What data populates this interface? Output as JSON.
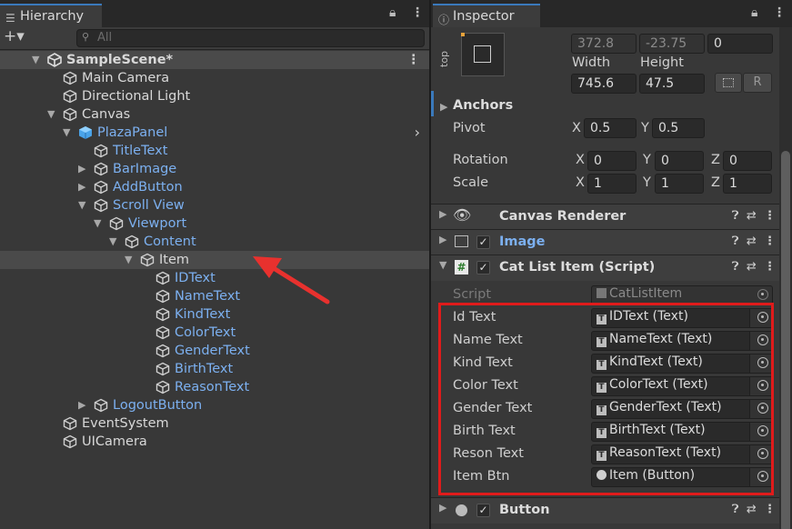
{
  "hierarchy": {
    "tab_title": "Hierarchy",
    "search_placeholder": "All",
    "add_symbol": "+▾",
    "rows": [
      {
        "label": "SampleScene*",
        "depth": 0,
        "arrow": "down",
        "icon": "unity-scene-icon",
        "color": "white",
        "type": "scene"
      },
      {
        "label": "Main Camera",
        "depth": 1,
        "arrow": "",
        "icon": "gameobject-cube-icon",
        "color": "white"
      },
      {
        "label": "Directional Light",
        "depth": 1,
        "arrow": "",
        "icon": "gameobject-cube-icon",
        "color": "white"
      },
      {
        "label": "Canvas",
        "depth": 1,
        "arrow": "down",
        "icon": "gameobject-cube-icon",
        "color": "white"
      },
      {
        "label": "PlazaPanel",
        "depth": 2,
        "arrow": "down",
        "icon": "prefab-cube-icon",
        "color": "blue",
        "chevron": true
      },
      {
        "label": "TitleText",
        "depth": 3,
        "arrow": "",
        "icon": "gameobject-cube-icon",
        "color": "blue"
      },
      {
        "label": "BarImage",
        "depth": 3,
        "arrow": "right",
        "icon": "gameobject-cube-icon",
        "color": "blue"
      },
      {
        "label": "AddButton",
        "depth": 3,
        "arrow": "right",
        "icon": "gameobject-cube-icon",
        "color": "blue"
      },
      {
        "label": "Scroll View",
        "depth": 3,
        "arrow": "down",
        "icon": "gameobject-cube-icon",
        "color": "blue"
      },
      {
        "label": "Viewport",
        "depth": 4,
        "arrow": "down",
        "icon": "gameobject-cube-icon",
        "color": "blue"
      },
      {
        "label": "Content",
        "depth": 5,
        "arrow": "down",
        "icon": "gameobject-cube-icon",
        "color": "blue"
      },
      {
        "label": "Item",
        "depth": 6,
        "arrow": "down",
        "icon": "gameobject-cube-icon",
        "color": "white",
        "selected": true
      },
      {
        "label": "IDText",
        "depth": 7,
        "arrow": "",
        "icon": "gameobject-cube-icon",
        "color": "blue"
      },
      {
        "label": "NameText",
        "depth": 7,
        "arrow": "",
        "icon": "gameobject-cube-icon",
        "color": "blue"
      },
      {
        "label": "KindText",
        "depth": 7,
        "arrow": "",
        "icon": "gameobject-cube-icon",
        "color": "blue"
      },
      {
        "label": "ColorText",
        "depth": 7,
        "arrow": "",
        "icon": "gameobject-cube-icon",
        "color": "blue"
      },
      {
        "label": "GenderText",
        "depth": 7,
        "arrow": "",
        "icon": "gameobject-cube-icon",
        "color": "blue"
      },
      {
        "label": "BirthText",
        "depth": 7,
        "arrow": "",
        "icon": "gameobject-cube-icon",
        "color": "blue"
      },
      {
        "label": "ReasonText",
        "depth": 7,
        "arrow": "",
        "icon": "gameobject-cube-icon",
        "color": "blue"
      },
      {
        "label": "LogoutButton",
        "depth": 3,
        "arrow": "right",
        "icon": "gameobject-cube-icon",
        "color": "blue"
      },
      {
        "label": "EventSystem",
        "depth": 1,
        "arrow": "",
        "icon": "gameobject-cube-icon",
        "color": "white"
      },
      {
        "label": "UICamera",
        "depth": 1,
        "arrow": "",
        "icon": "gameobject-cube-icon",
        "color": "white"
      }
    ]
  },
  "inspector": {
    "tab_title": "Inspector",
    "rect": {
      "anchor_preset_label": "top",
      "pos_x": "372.8",
      "pos_y": "-23.75",
      "pos_z": "0",
      "width_label": "Width",
      "height_label": "Height",
      "width": "745.6",
      "height": "47.5",
      "raw_button": "R"
    },
    "anchors_label": "Anchors",
    "pivot": {
      "label": "Pivot",
      "x_label": "X",
      "y_label": "Y",
      "x": "0.5",
      "y": "0.5"
    },
    "rotation": {
      "label": "Rotation",
      "x_label": "X",
      "y_label": "Y",
      "z_label": "Z",
      "x": "0",
      "y": "0",
      "z": "0"
    },
    "scale": {
      "label": "Scale",
      "x_label": "X",
      "y_label": "Y",
      "z_label": "Z",
      "x": "1",
      "y": "1",
      "z": "1"
    },
    "components": {
      "canvas_renderer": "Canvas Renderer",
      "image": "Image",
      "cat_list_item": "Cat List Item (Script)",
      "button": "Button"
    },
    "script_field": {
      "label": "Script",
      "value": "CatListItem"
    },
    "fields": [
      {
        "label": "Id Text",
        "value": "IDText (Text)",
        "icon": "T"
      },
      {
        "label": "Name Text",
        "value": "NameText (Text)",
        "icon": "T"
      },
      {
        "label": "Kind Text",
        "value": "KindText (Text)",
        "icon": "T"
      },
      {
        "label": "Color Text",
        "value": "ColorText (Text)",
        "icon": "T"
      },
      {
        "label": "Gender Text",
        "value": "GenderText (Text)",
        "icon": "T"
      },
      {
        "label": "Birth Text",
        "value": "BirthText (Text)",
        "icon": "T"
      },
      {
        "label": "Reson Text",
        "value": "ReasonText (Text)",
        "icon": "T"
      },
      {
        "label": "Item Btn",
        "value": "Item (Button)",
        "icon": "◉"
      }
    ]
  },
  "colors": {
    "highlight_box": "#e01b1b",
    "arrow": "#e8312e",
    "prefab_text": "#7cb0f0",
    "tab_accent": "#3a79bb"
  }
}
